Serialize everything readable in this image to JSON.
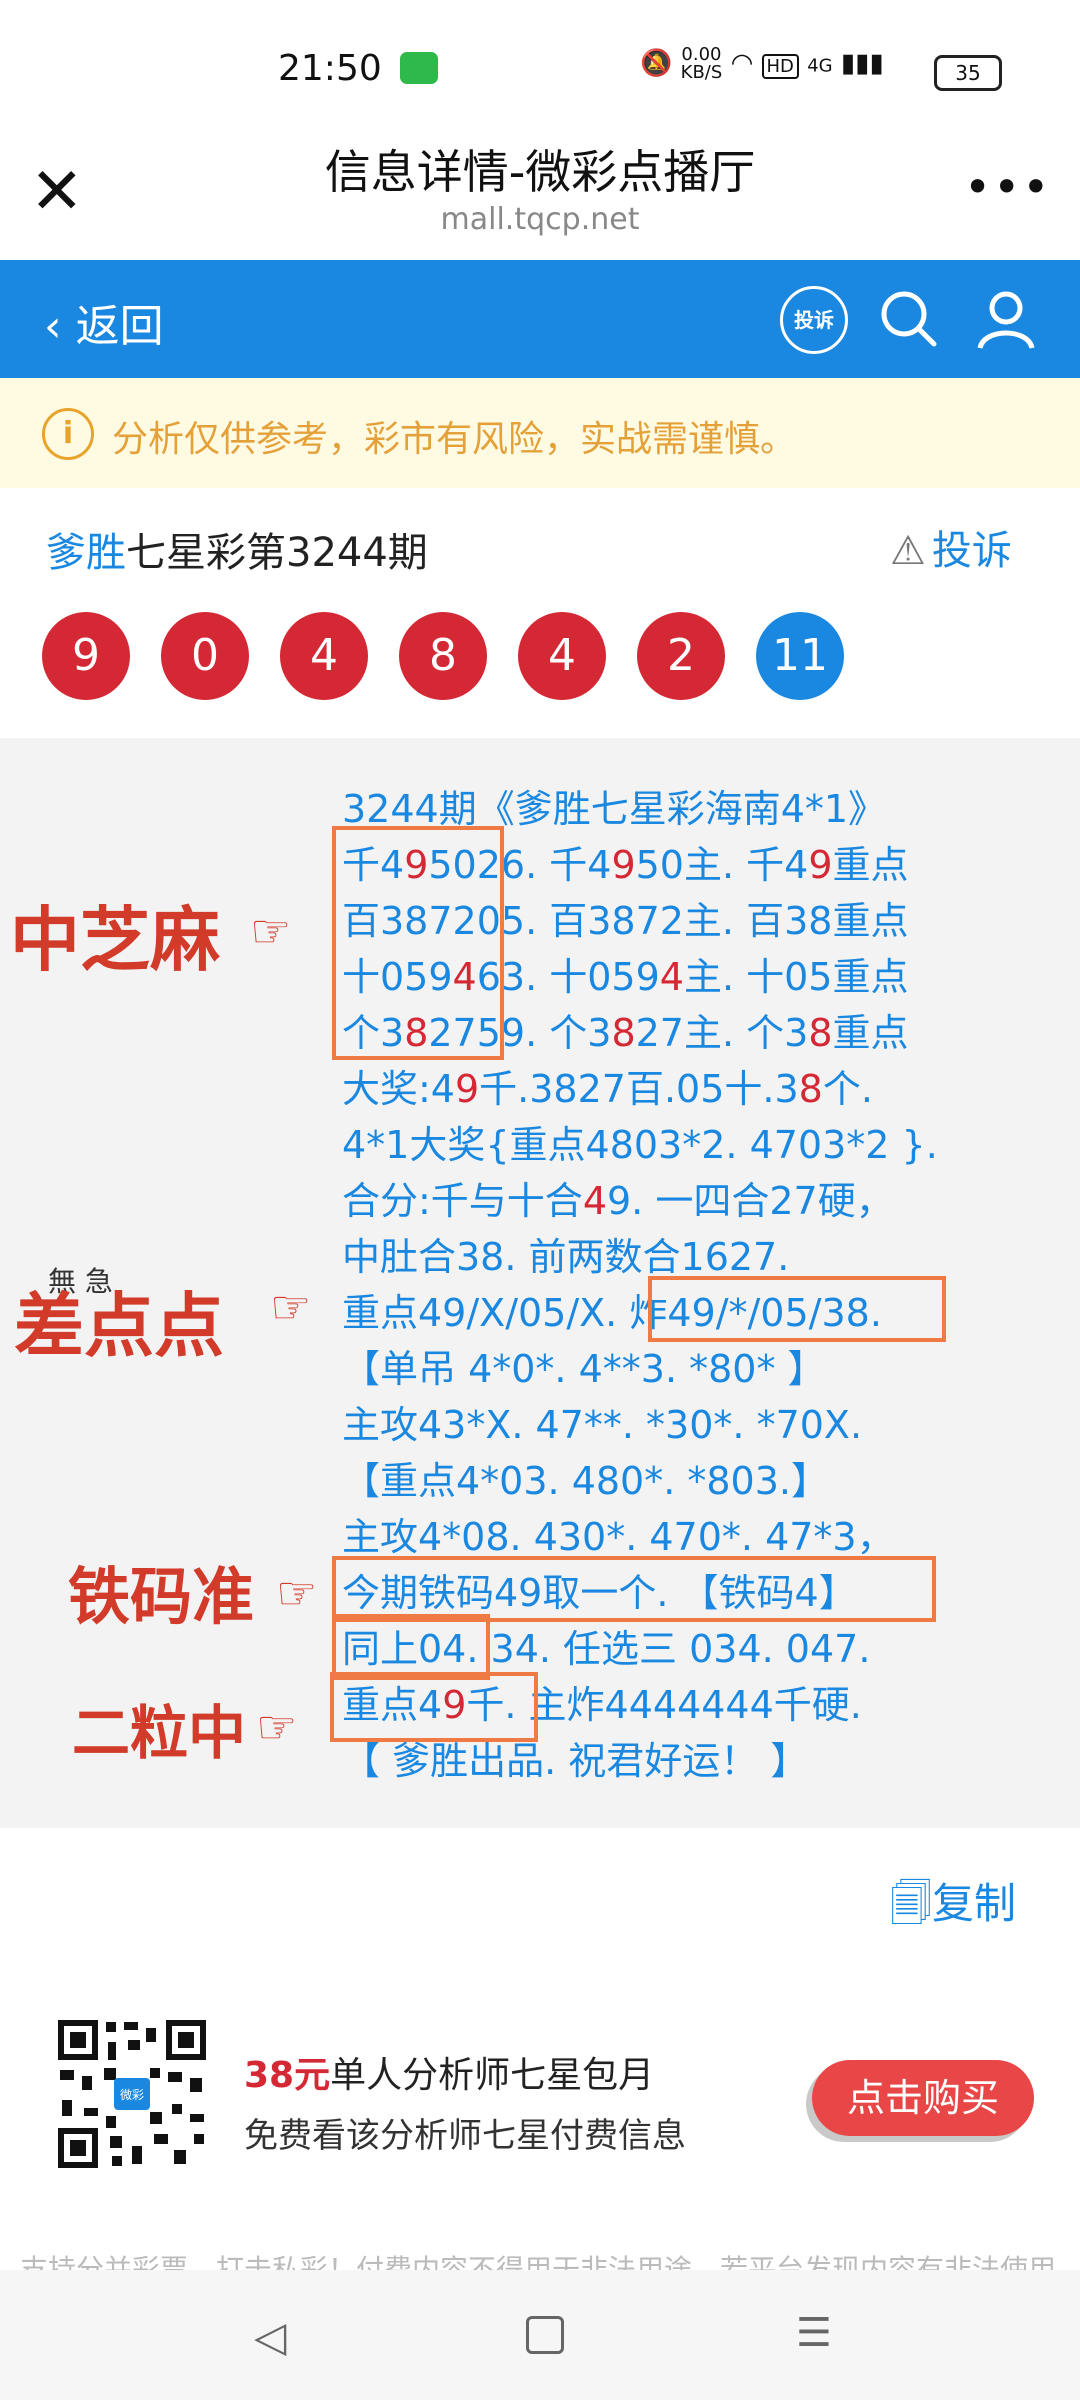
{
  "status": {
    "time": "21:50",
    "speed_value": "0.00",
    "speed_unit": "KB/S",
    "hd": "HD",
    "network": "4G",
    "battery": "35"
  },
  "titlebar": {
    "title": "信息详情-微彩点播厅",
    "url": "mall.tqcp.net",
    "close_icon": "close-icon",
    "more_icon": "more-icon"
  },
  "nav": {
    "back_label": "返回",
    "complain_badge": "投诉",
    "search_icon": "search-icon",
    "user_icon": "user-icon",
    "color": "#1a88e0"
  },
  "warning": {
    "text": "分析仅供参考，彩市有风险，实战需谨慎。"
  },
  "issue": {
    "author": "爹胜",
    "title": "七星彩第3244期",
    "report_label": "投诉"
  },
  "balls": [
    {
      "value": "9",
      "color": "red"
    },
    {
      "value": "0",
      "color": "red"
    },
    {
      "value": "4",
      "color": "red"
    },
    {
      "value": "8",
      "color": "red"
    },
    {
      "value": "4",
      "color": "red"
    },
    {
      "value": "2",
      "color": "red"
    },
    {
      "value": "11",
      "color": "blue"
    }
  ],
  "content": {
    "l1": "3244期《爹胜七星彩海南4*1》",
    "l2a": "千4",
    "l2b": "9",
    "l2c": "5026.",
    "l2d": " 千4",
    "l2e": "9",
    "l2f": "50主. 千4",
    "l2g": "9",
    "l2h": "重点",
    "l3a": "百38720",
    "l3b": "",
    "l3c": "5. 百3872主. 百38重点",
    "l4a": "十059",
    "l4b": "4",
    "l4c": "63.",
    "l4d": " 十059",
    "l4e": "4",
    "l4f": "主. 十05重点",
    "l5a": "个3",
    "l5b": "8",
    "l5c": "2759.",
    "l5d": " 个3",
    "l5e": "8",
    "l5f": "27主. 个3",
    "l5g": "8",
    "l5h": "重点",
    "l6a": "大奖:4",
    "l6b": "9",
    "l6c": "千.3827百.05十.3",
    "l6d": "8",
    "l6e": "个.",
    "l7": "4*1大奖{重点4803*2. 4703*2 }.",
    "l8a": "合分:千与十合",
    "l8b": "4",
    "l8c": "9. 一四合27硬，",
    "l9": "中肚合38. 前两数合1627.",
    "l10a": "重点49/X/05/X. ",
    "l10b": "炸49/*/05/38.",
    "l11": "【单吊 4*0*. 4**3. *80* 】",
    "l12": "主攻43*X. 47**. *30*. *70X.",
    "l13": "【重点4*03. 480*. *803.】",
    "l14": "主攻4*08. 430*. 470*. 47*3，",
    "l15": "今期铁码49取一个. 【铁码4】",
    "l16a": "同上04.",
    "l16b": " 34. 任选三 034. 047.",
    "l17a": "重点4",
    "l17b": "9",
    "l17c": "千.",
    "l17d": " 主炸4444444千硬.",
    "l18": "【 爹胜出品. 祝君好运！ 】"
  },
  "stamps": {
    "s1": "中芝麻",
    "s2": "差点点",
    "s2_small": "無 急",
    "s3": "铁码准",
    "s4": "二粒中",
    "hand_icon": "pointing-hand-icon"
  },
  "copy_label": "复制",
  "ad": {
    "price": "38元",
    "title": "单人分析师七星包月",
    "subtitle": "免费看该分析师七星付费信息",
    "button": "点击购买",
    "qr_center": "微彩"
  },
  "footer_text": "支持分并彩票，打击私彩！付费内容不得用于非法用途，若平台发现内容有非法使用，将会"
}
